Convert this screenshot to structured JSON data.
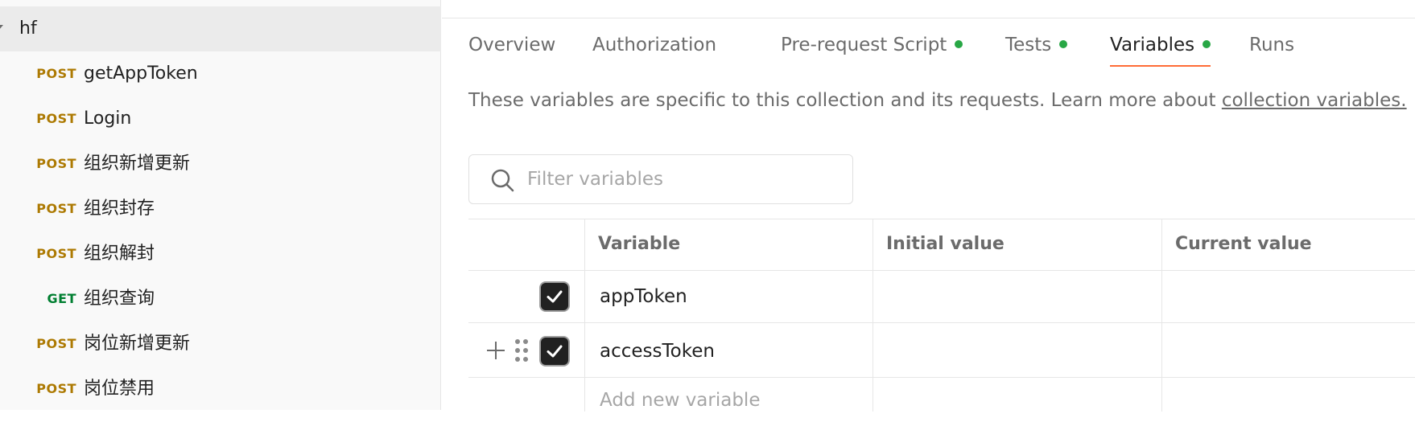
{
  "sidebar": {
    "folder": {
      "name": "hf"
    },
    "requests": [
      {
        "method": "POST",
        "name": "getAppToken"
      },
      {
        "method": "POST",
        "name": "Login"
      },
      {
        "method": "POST",
        "name": "组织新增更新"
      },
      {
        "method": "POST",
        "name": "组织封存"
      },
      {
        "method": "POST",
        "name": "组织解封"
      },
      {
        "method": "GET",
        "name": "组织查询"
      },
      {
        "method": "POST",
        "name": "岗位新增更新"
      },
      {
        "method": "POST",
        "name": "岗位禁用"
      }
    ]
  },
  "tabs": [
    {
      "label": "Overview",
      "active": false,
      "dot": false
    },
    {
      "label": "Authorization",
      "active": false,
      "dot": false
    },
    {
      "label": "Pre-request Script",
      "active": false,
      "dot": true
    },
    {
      "label": "Tests",
      "active": false,
      "dot": true
    },
    {
      "label": "Variables",
      "active": true,
      "dot": true
    },
    {
      "label": "Runs",
      "active": false,
      "dot": false
    }
  ],
  "description": {
    "text": "These variables are specific to this collection and its requests. Learn more about ",
    "link": "collection variables."
  },
  "filter": {
    "placeholder": "Filter variables",
    "value": ""
  },
  "table": {
    "headers": {
      "variable": "Variable",
      "initial": "Initial value",
      "current": "Current value"
    },
    "rows": [
      {
        "checked": true,
        "variable": "appToken",
        "initial": "",
        "current": ""
      },
      {
        "checked": true,
        "variable": "accessToken",
        "initial": "",
        "current": ""
      }
    ],
    "add_placeholder": "Add new variable"
  },
  "colors": {
    "accent": "#ff6c37",
    "post": "#ad7a03",
    "get": "#007f31",
    "status_dot": "#28a745"
  },
  "icons": {
    "search": "search-icon",
    "checkbox": "check-icon",
    "add": "plus-icon",
    "drag": "drag-handle-icon",
    "folder": "caret-down-icon"
  }
}
